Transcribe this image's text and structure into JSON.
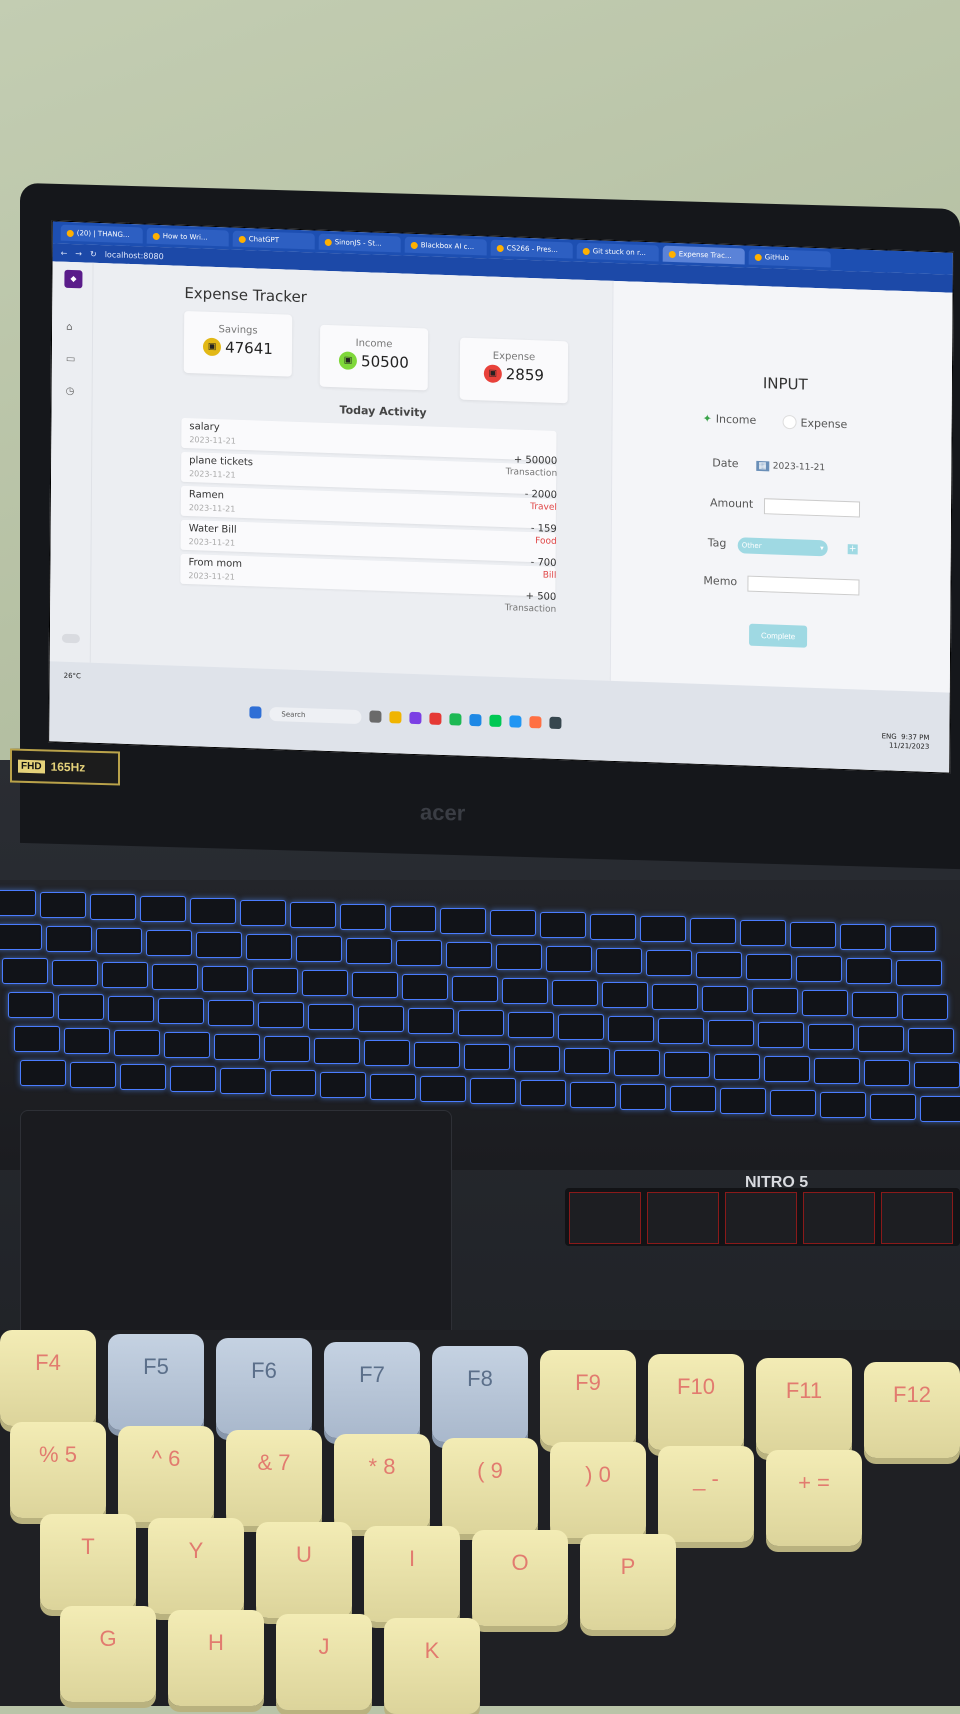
{
  "browser": {
    "tabs": [
      {
        "label": "(20) | THANG..."
      },
      {
        "label": "How to Wri..."
      },
      {
        "label": "ChatGPT"
      },
      {
        "label": "SinonJS - St..."
      },
      {
        "label": "Blackbox AI c..."
      },
      {
        "label": "CS266 - Pres..."
      },
      {
        "label": "Git stuck on r..."
      },
      {
        "label": "Expense Trac..."
      },
      {
        "label": "GitHub"
      }
    ],
    "url": "localhost:8080"
  },
  "app": {
    "title": "Expense Tracker",
    "cards": [
      {
        "label": "Savings",
        "value": "47641",
        "color": "#e2b816"
      },
      {
        "label": "Income",
        "value": "50500",
        "color": "#7fd83a"
      },
      {
        "label": "Expense",
        "value": "2859",
        "color": "#e8413a"
      }
    ],
    "activity_title": "Today Activity",
    "activities": [
      {
        "name": "salary",
        "date": "2023-11-21",
        "amount": "+ 50000",
        "category": "Transaction",
        "cat_color": "#777777"
      },
      {
        "name": "plane tickets",
        "date": "2023-11-21",
        "amount": "- 2000",
        "category": "Travel",
        "cat_color": "#e04848"
      },
      {
        "name": "Ramen",
        "date": "2023-11-21",
        "amount": "- 159",
        "category": "Food",
        "cat_color": "#e04848"
      },
      {
        "name": "Water Bill",
        "date": "2023-11-21",
        "amount": "- 700",
        "category": "Bill",
        "cat_color": "#e04848"
      },
      {
        "name": "From mom",
        "date": "2023-11-21",
        "amount": "+ 500",
        "category": "Transaction",
        "cat_color": "#777777"
      }
    ],
    "input": {
      "title": "INPUT",
      "income_label": "Income",
      "expense_label": "Expense",
      "date_label": "Date",
      "date_value": "2023-11-21",
      "amount_label": "Amount",
      "tag_label": "Tag",
      "tag_value": "Other",
      "memo_label": "Memo",
      "complete_label": "Complete"
    }
  },
  "taskbar": {
    "weather": "26°C",
    "search": "Search",
    "lang": "ENG",
    "time": "9:37 PM",
    "date": "11/21/2023"
  },
  "laptop": {
    "badge_fhd": "FHD",
    "badge_hz": "165Hz",
    "brand": "acer",
    "model": "NITRO 5"
  },
  "mech_keys": {
    "row1": [
      "F4",
      "F5",
      "F6",
      "F7",
      "F8",
      "F9",
      "F10",
      "F11",
      "F12"
    ],
    "row2": [
      "%\n5",
      "^\n6",
      "&\n7",
      "*\n8",
      "(\n9",
      ")\n0",
      "_\n-",
      "+\n="
    ],
    "row3": [
      "T",
      "Y",
      "U",
      "I",
      "O",
      "P"
    ],
    "row4": [
      "G",
      "H",
      "J",
      "K"
    ]
  }
}
